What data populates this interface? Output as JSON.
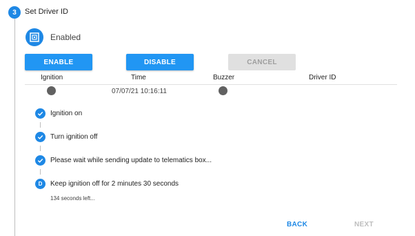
{
  "step": {
    "number": "3",
    "title": "Set Driver ID"
  },
  "status": {
    "label": "Enabled",
    "icon": "driver-id-icon"
  },
  "buttons": {
    "enable": "ENABLE",
    "disable": "DISABLE",
    "cancel": "CANCEL"
  },
  "table": {
    "headers": {
      "ignition": "Ignition",
      "time": "Time",
      "buzzer": "Buzzer",
      "driver_id": "Driver ID"
    },
    "row": {
      "ignition": "off",
      "time": "07/07/21 10:16:11",
      "buzzer": "off",
      "driver_id": ""
    }
  },
  "tasks": [
    {
      "label": "Ignition on",
      "state": "done"
    },
    {
      "label": "Turn ignition off",
      "state": "done"
    },
    {
      "label": "Please wait while sending update to telematics box...",
      "state": "done"
    },
    {
      "label": "Keep ignition off for 2 minutes 30 seconds",
      "state": "active",
      "badge": "D"
    }
  ],
  "countdown": "134 seconds left...",
  "nav": {
    "back": "BACK",
    "next": "NEXT"
  },
  "colors": {
    "accent": "#1e88e5",
    "button": "#2196f3",
    "disabled": "#e0e0e0",
    "indicator": "#616161"
  }
}
